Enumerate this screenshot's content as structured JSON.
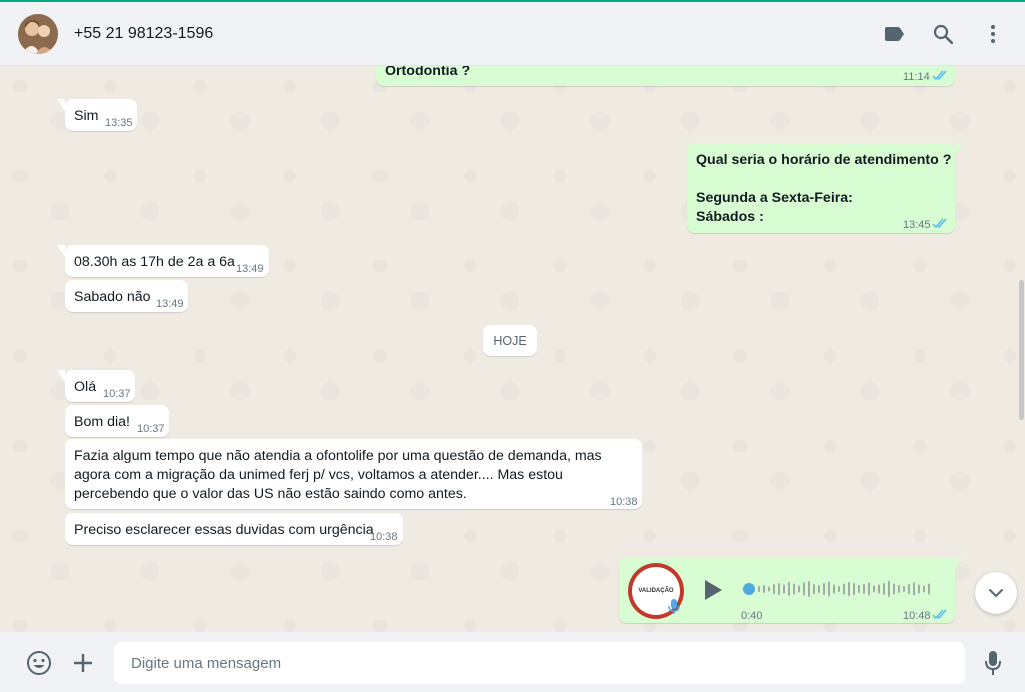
{
  "header": {
    "contact_name": "+55 21 98123-1596",
    "icons": [
      "label-icon",
      "search-icon",
      "menu-icon"
    ]
  },
  "messages": [
    {
      "direction": "out",
      "text": "Ortodontia ?",
      "time": "11:14",
      "status": "read"
    },
    {
      "direction": "in",
      "text": "Sim",
      "time": "13:35"
    },
    {
      "direction": "out",
      "lines": [
        "Qual seria o horário de atendimento ?",
        "",
        "Segunda a Sexta-Feira:",
        "Sábados :"
      ],
      "time": "13:45",
      "status": "read"
    },
    {
      "direction": "in",
      "text": "08.30h as 17h de 2a a 6a",
      "time": "13:49"
    },
    {
      "direction": "in",
      "text": "Sabado não",
      "time": "13:49"
    },
    {
      "direction": "in",
      "text": "Olá",
      "time": "10:37"
    },
    {
      "direction": "in",
      "text": "Bom dia!",
      "time": "10:37"
    },
    {
      "direction": "in",
      "lines": [
        "Fazia algum tempo que não atendia a ofontolife por uma questão de demanda, mas",
        "agora com a migração da unimed ferj p/ vcs, voltamos a atender.... Mas estou",
        "percebendo que o valor das US não estão saindo como antes."
      ],
      "time": "10:38"
    },
    {
      "direction": "in",
      "text": "Preciso esclarecer essas duvidas com urgência",
      "time": "10:38"
    }
  ],
  "date_divider": "HOJE",
  "voice_message": {
    "duration": "0:40",
    "time": "10:48",
    "status": "read",
    "avatar_text": "VALIDAÇÃO",
    "played_fraction": 0
  },
  "composer": {
    "placeholder": "Digite uma mensagem"
  },
  "colors": {
    "accent": "#00a884",
    "outgoing_bubble": "#d9fdd3",
    "incoming_bubble": "#ffffff",
    "read_ticks": "#53bdeb",
    "background": "#efeae2"
  }
}
